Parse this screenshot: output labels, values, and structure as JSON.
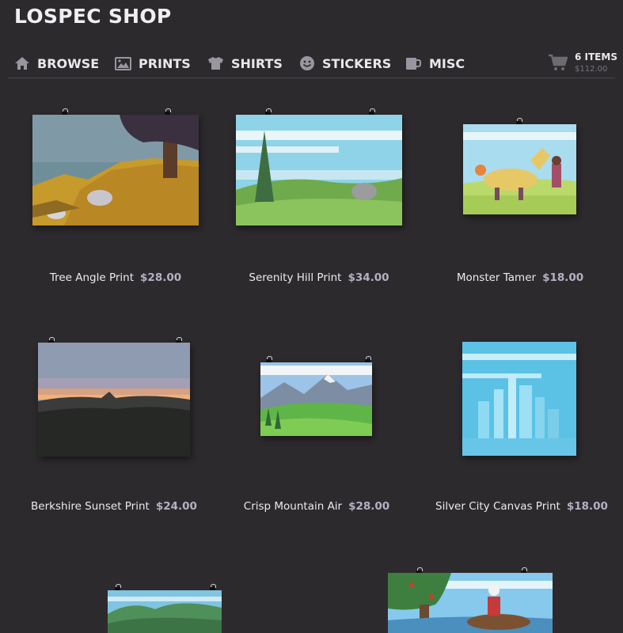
{
  "shop": {
    "title": "LOSPEC SHOP"
  },
  "nav": {
    "browse": "BROWSE",
    "prints": "PRINTS",
    "shirts": "SHIRTS",
    "stickers": "STICKERS",
    "misc": "MISC"
  },
  "cart": {
    "count": "6 ITEMS",
    "total": "$112.00"
  },
  "products": [
    {
      "name": "Tree Angle Print",
      "price": "$28.00"
    },
    {
      "name": "Serenity Hill Print",
      "price": "$34.00"
    },
    {
      "name": "Monster Tamer",
      "price": "$18.00"
    },
    {
      "name": "Berkshire Sunset Print",
      "price": "$24.00"
    },
    {
      "name": "Crisp Mountain Air",
      "price": "$28.00"
    },
    {
      "name": "Silver City Canvas Print",
      "price": "$18.00"
    }
  ],
  "colors": {
    "background": "#2d2a2e",
    "price": "#b4b0c4",
    "nav_icon": "#9a96a0"
  }
}
